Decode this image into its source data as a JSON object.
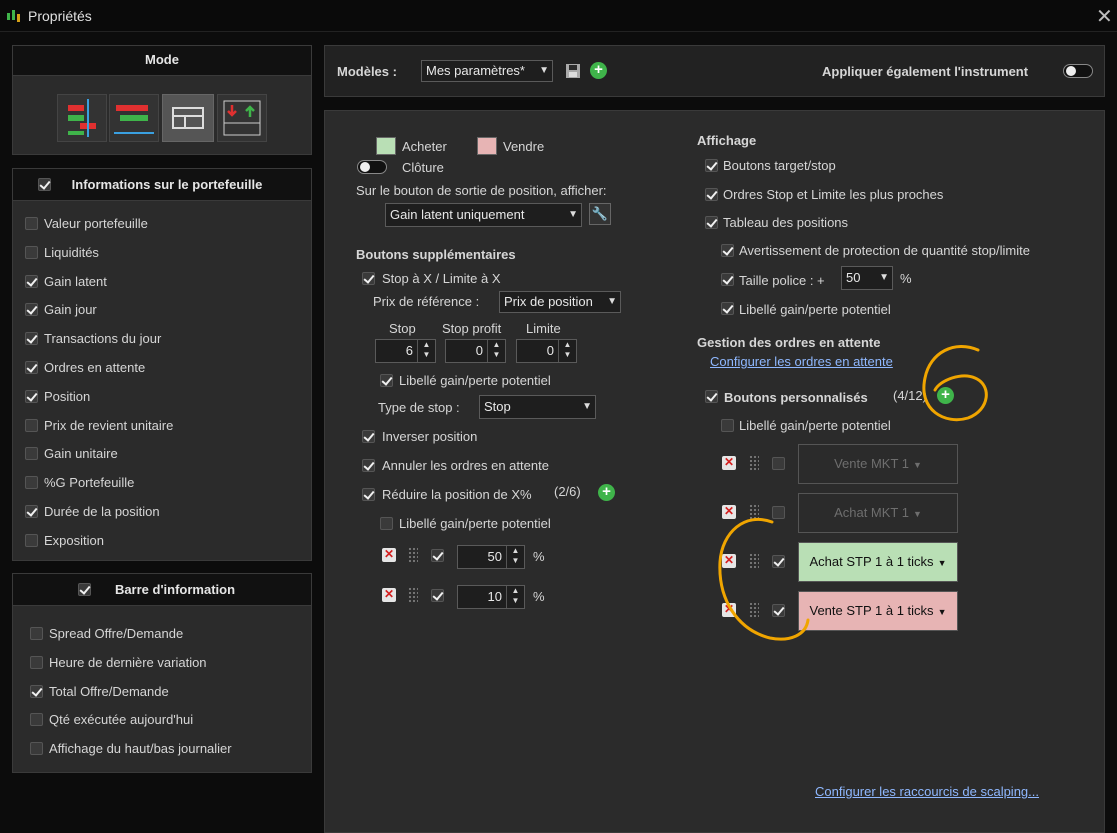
{
  "window": {
    "title": "Propriétés",
    "close_icon": "close-icon"
  },
  "left": {
    "mode_header": "Mode",
    "portfolio_header": "Informations sur le portefeuille",
    "portfolio_items": [
      {
        "label": "Valeur portefeuille",
        "checked": false
      },
      {
        "label": "Liquidités",
        "checked": false
      },
      {
        "label": "Gain latent",
        "checked": true
      },
      {
        "label": "Gain jour",
        "checked": true
      },
      {
        "label": "Transactions du jour",
        "checked": true
      },
      {
        "label": "Ordres en attente",
        "checked": true
      },
      {
        "label": "Position",
        "checked": true
      },
      {
        "label": "Prix de revient unitaire",
        "checked": false
      },
      {
        "label": "Gain unitaire",
        "checked": false
      },
      {
        "label": "%G Portefeuille",
        "checked": false
      },
      {
        "label": "Durée de la position",
        "checked": true
      },
      {
        "label": "Exposition",
        "checked": false
      }
    ],
    "infobar_header": "Barre d'information",
    "infobar_items": [
      {
        "label": "Spread Offre/Demande",
        "checked": false
      },
      {
        "label": "Heure de dernière variation",
        "checked": false
      },
      {
        "label": "Total Offre/Demande",
        "checked": true
      },
      {
        "label": "Qté exécutée aujourd'hui",
        "checked": false
      },
      {
        "label": "Affichage du haut/bas journalier",
        "checked": false
      }
    ]
  },
  "top": {
    "models_label": "Modèles :",
    "models_value": "Mes paramètres*",
    "apply_label": "Appliquer également l'instrument"
  },
  "main": {
    "buy_label": "Acheter",
    "sell_label": "Vendre",
    "close_label": "Clôture",
    "exit_label": "Sur le bouton de sortie de position, afficher:",
    "exit_value": "Gain latent uniquement",
    "extra_header": "Boutons supplémentaires",
    "stop_limit_label": "Stop à X / Limite à X",
    "ref_price_label": "Prix de référence :",
    "ref_price_value": "Prix de position",
    "col_stop": "Stop",
    "col_stop_profit": "Stop profit",
    "col_limit": "Limite",
    "stop_val": "6",
    "stop_profit_val": "0",
    "limit_val": "0",
    "potential_label": "Libellé gain/perte potentiel",
    "stop_type_label": "Type de stop :",
    "stop_type_value": "Stop",
    "reverse_label": "Inverser position",
    "cancel_orders_label": "Annuler les ordres en attente",
    "reduce_label": "Réduire la position de X%",
    "reduce_count": "(2/6)",
    "reduce_potential_label": "Libellé gain/perte potentiel",
    "reduce_rows": [
      {
        "value": "50",
        "unit": "%"
      },
      {
        "value": "10",
        "unit": "%"
      }
    ],
    "display_header": "Affichage",
    "display_items": [
      "Boutons target/stop",
      "Ordres Stop et Limite les plus proches",
      "Tableau des positions"
    ],
    "sub_items_1": "Avertissement de protection de quantité stop/limite",
    "font_size_label": "Taille police : +",
    "font_size_value": "50",
    "font_size_unit": "%",
    "sub_items_3": "Libellé gain/perte potentiel",
    "pending_header": "Gestion des ordres en attente",
    "pending_link": "Configurer les ordres en attente",
    "custom_label": "Boutons personnalisés",
    "custom_count": "(4/12)",
    "custom_potential_label": "Libellé gain/perte potentiel",
    "custom_buttons": [
      {
        "label": "Vente MKT 1",
        "checked": false,
        "bg": "#2b2b2b",
        "fg": "#6e6e6e"
      },
      {
        "label": "Achat MKT 1",
        "checked": false,
        "bg": "#2b2b2b",
        "fg": "#6e6e6e"
      },
      {
        "label": "Achat STP 1 à 1 ticks",
        "checked": true,
        "bg": "#b9dfb5",
        "fg": "#111111"
      },
      {
        "label": "Vente STP 1 à 1 ticks",
        "checked": true,
        "bg": "#e7b4b4",
        "fg": "#111111"
      }
    ],
    "scalping_link": "Configurer les raccourcis de scalping..."
  },
  "colors": {
    "buy": "#b9dfb5",
    "sell": "#e7b4b4",
    "annotation": "#f0a500",
    "accent": "#3fb44a"
  }
}
